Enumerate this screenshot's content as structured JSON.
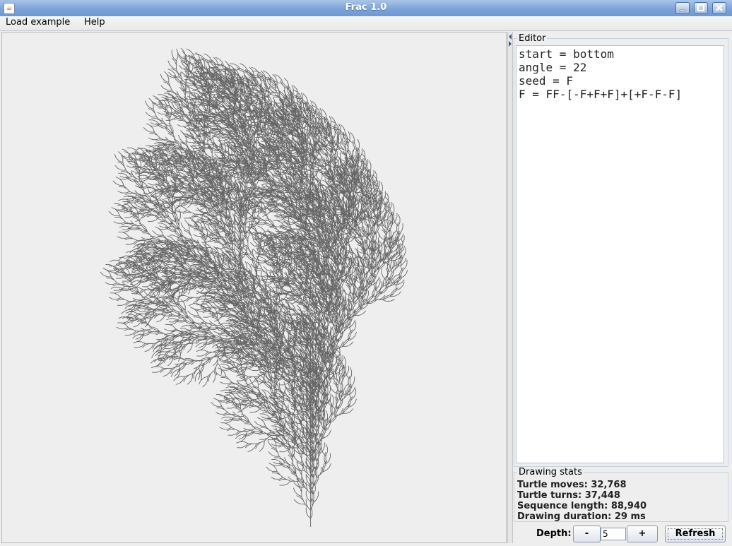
{
  "window": {
    "title": "Frac 1.0",
    "icon": "java-cup-icon"
  },
  "menu": {
    "items": [
      "Load example",
      "Help"
    ]
  },
  "editor": {
    "legend": "Editor",
    "lines": [
      "start = bottom",
      "angle = 22",
      "seed = F",
      "F = FF-[-F+F+F]+[+F-F-F]"
    ]
  },
  "stats": {
    "legend": "Drawing stats",
    "moves": "Turtle moves: 32,768",
    "turns": "Turtle turns: 37,448",
    "sequence": "Sequence length: 88,940",
    "duration": "Drawing duration: 29 ms"
  },
  "controls": {
    "depth_label": "Depth:",
    "minus": "-",
    "depth_value": "5",
    "plus": "+",
    "refresh": "Refresh"
  },
  "colors": {
    "title_gradient_top": "#a9c4e8",
    "title_gradient_bottom": "#6f97d2",
    "stroke": "#666666"
  }
}
